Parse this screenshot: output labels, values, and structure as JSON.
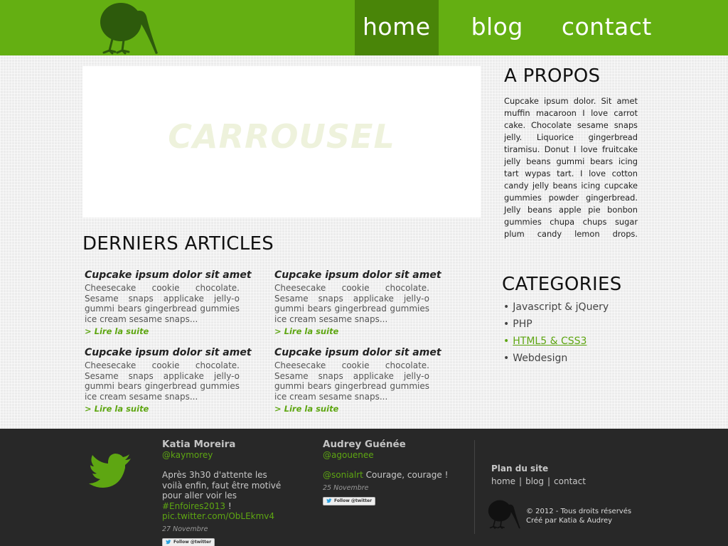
{
  "nav": {
    "items": [
      {
        "label": "home",
        "active": true
      },
      {
        "label": "blog",
        "active": false
      },
      {
        "label": "contact",
        "active": false
      }
    ]
  },
  "carousel": {
    "label": "CARROUSEL"
  },
  "articles": {
    "title": "DERNIERS ARTICLES",
    "items": [
      {
        "title": "Cupcake ipsum dolor sit amet",
        "excerpt": "Cheesecake cookie chocolate. Sesame snaps applicake jelly-o gummi bears gingerbread gummies ice cream sesame snaps...",
        "more": "> Lire la suite"
      },
      {
        "title": "Cupcake ipsum dolor sit amet",
        "excerpt": "Cheesecake cookie chocolate. Sesame snaps applicake jelly-o gummi bears gingerbread gummies ice cream sesame snaps...",
        "more": "> Lire la suite"
      },
      {
        "title": "Cupcake ipsum dolor sit amet",
        "excerpt": "Cheesecake cookie chocolate. Sesame snaps applicake jelly-o gummi bears gingerbread gummies ice cream sesame snaps...",
        "more": "> Lire la suite"
      },
      {
        "title": "Cupcake ipsum dolor sit amet",
        "excerpt": "Cheesecake cookie chocolate. Sesame snaps applicake jelly-o gummi bears gingerbread gummies ice cream sesame snaps...",
        "more": "> Lire la suite"
      }
    ]
  },
  "about": {
    "title": "A PROPOS",
    "text": "Cupcake ipsum dolor. Sit amet muffin macaroon I love carrot cake. Chocolate sesame snaps jelly. Liquorice gingerbread tiramisu. Donut I love fruitcake jelly beans gummi bears icing tart wypas tart. I love cotton candy jelly beans icing cupcake gummies powder gingerbread. Jelly beans apple pie bonbon gummies chupa chups sugar plum candy lemon drops."
  },
  "categories": {
    "title": "CATEGORIES",
    "bullet": "•",
    "items": [
      {
        "label": "Javascript & jQuery",
        "active": false
      },
      {
        "label": "PHP",
        "active": false
      },
      {
        "label": "HTML5 & CSS3",
        "active": true
      },
      {
        "label": "Webdesign",
        "active": false
      }
    ]
  },
  "footer": {
    "tweets": [
      {
        "name": "Katia Moreira",
        "handle": "@kaymorey",
        "text_before": "Après 3h30 d'attente les voilà enfin, faut être motivé pour aller voir les ",
        "hashtag": "#Enfoires2013",
        "text_after": " !",
        "link": "pic.twitter.com/ObLEkmv4",
        "date": "27 Novembre",
        "follow": "Follow @twitter"
      },
      {
        "name": "Audrey Guénée",
        "handle": "@agouenee",
        "mention": "@sonialrt",
        "text": " Courage, courage !",
        "date": "25 Novembre",
        "follow": "Follow @twitter"
      }
    ],
    "sitemap": {
      "title": "Plan du site",
      "links": [
        "home",
        "blog",
        "contact"
      ],
      "separator": "|"
    },
    "copyright": {
      "line1": "© 2012 - Tous droits réservés",
      "line2": "Créé par Katia & Audrey"
    }
  },
  "colors": {
    "brand_green": "#64af12",
    "active_nav": "#498508",
    "link_green": "#5ea612",
    "footer_bg": "#282828",
    "kiwi_dark": "#2d5a0c"
  },
  "icons": {
    "logo": "kiwi-bird-icon",
    "twitter": "twitter-bird-icon",
    "footer_logo": "kiwi-bird-icon"
  }
}
